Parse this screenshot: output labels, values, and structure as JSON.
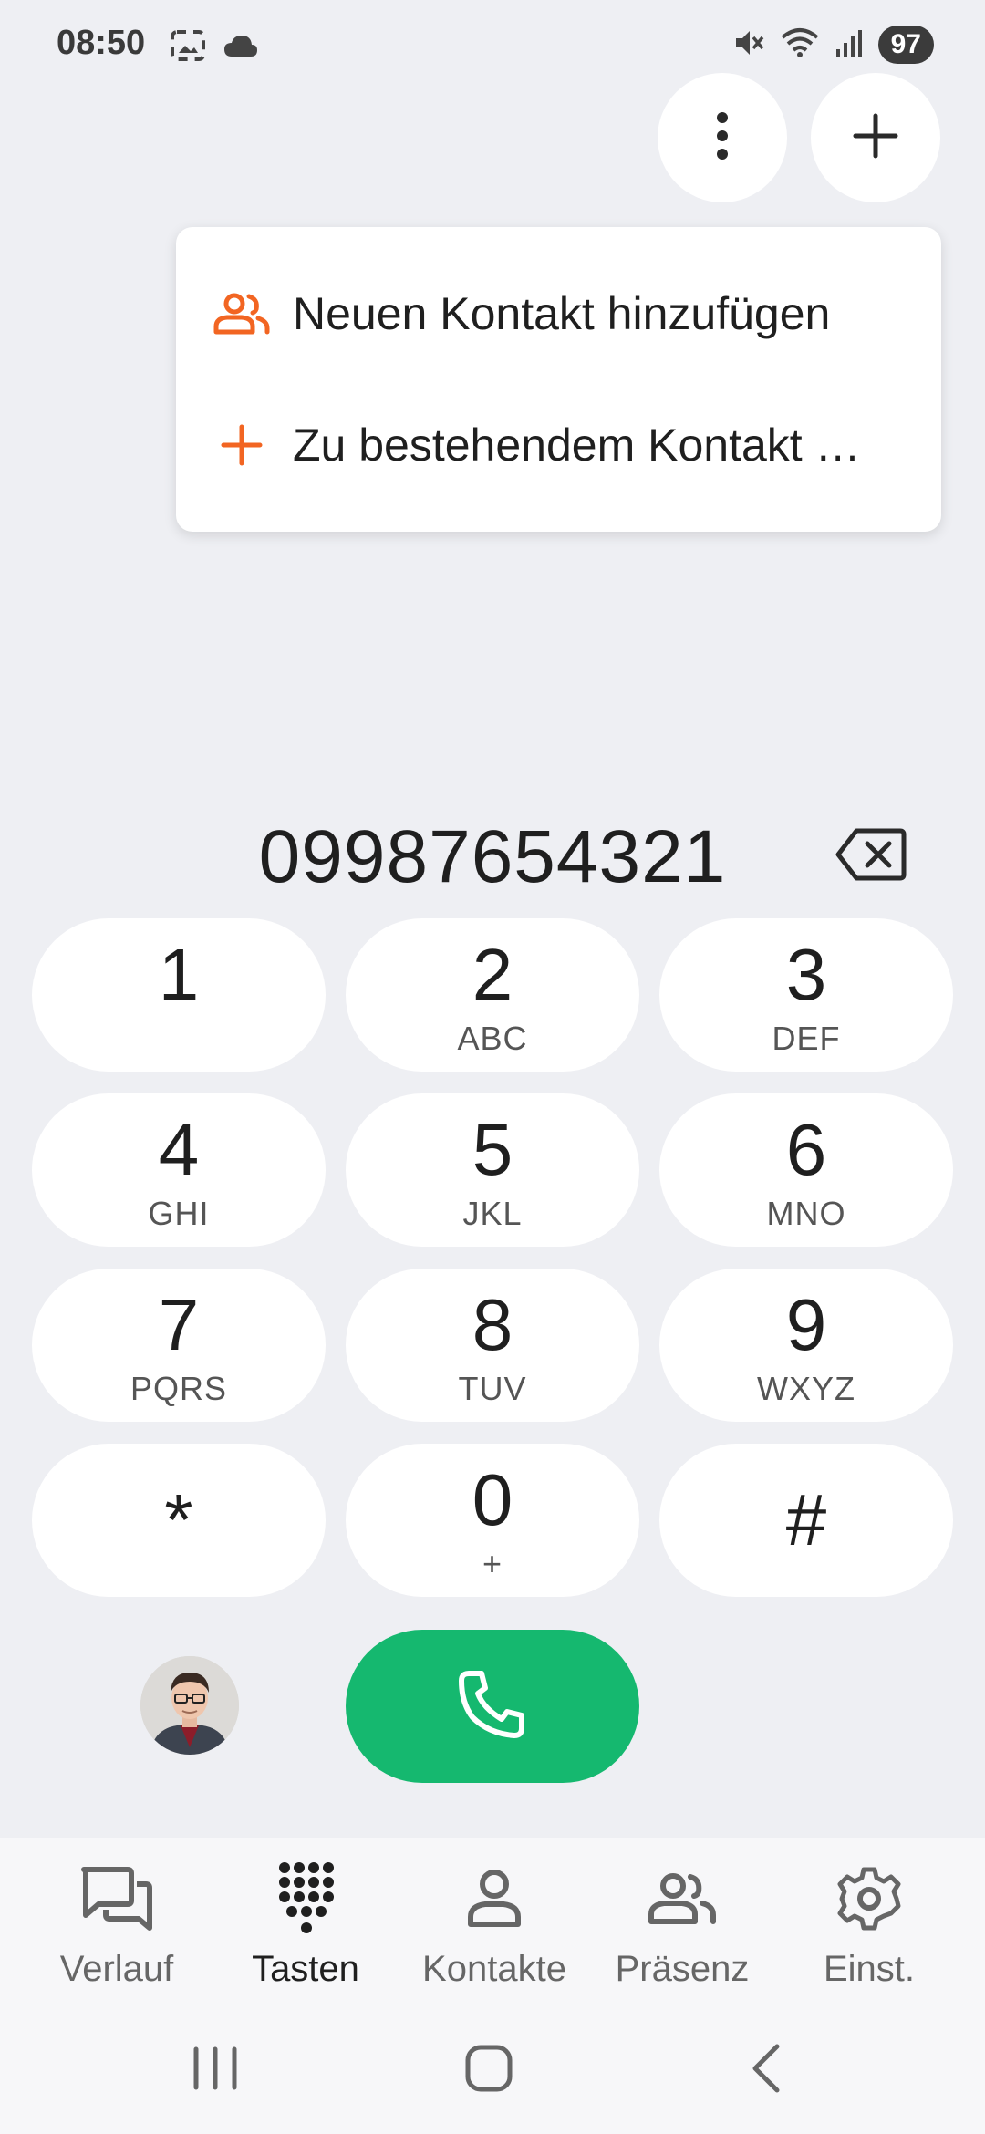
{
  "status_bar": {
    "time": "08:50",
    "battery": "97"
  },
  "menu": {
    "items": [
      {
        "label": "Neuen Kontakt hinzufügen",
        "icon": "contacts-icon"
      },
      {
        "label": "Zu bestehendem Kontakt …",
        "icon": "plus-icon"
      }
    ]
  },
  "dialer": {
    "number": "09987654321",
    "keys": [
      {
        "digit": "1",
        "letters": ""
      },
      {
        "digit": "2",
        "letters": "ABC"
      },
      {
        "digit": "3",
        "letters": "DEF"
      },
      {
        "digit": "4",
        "letters": "GHI"
      },
      {
        "digit": "5",
        "letters": "JKL"
      },
      {
        "digit": "6",
        "letters": "MNO"
      },
      {
        "digit": "7",
        "letters": "PQRS"
      },
      {
        "digit": "8",
        "letters": "TUV"
      },
      {
        "digit": "9",
        "letters": "WXYZ"
      },
      {
        "digit": "*",
        "letters": ""
      },
      {
        "digit": "0",
        "letters": "+"
      },
      {
        "digit": "#",
        "letters": ""
      }
    ]
  },
  "bottom_nav": {
    "items": [
      {
        "label": "Verlauf",
        "icon": "chat-icon",
        "active": false
      },
      {
        "label": "Tasten",
        "icon": "dialpad-icon",
        "active": true
      },
      {
        "label": "Kontakte",
        "icon": "person-icon",
        "active": false
      },
      {
        "label": "Präsenz",
        "icon": "people-icon",
        "active": false
      },
      {
        "label": "Einst.",
        "icon": "gear-icon",
        "active": false
      }
    ]
  },
  "colors": {
    "accent": "#f26522",
    "call": "#15b86f",
    "background": "#eeeff3"
  }
}
